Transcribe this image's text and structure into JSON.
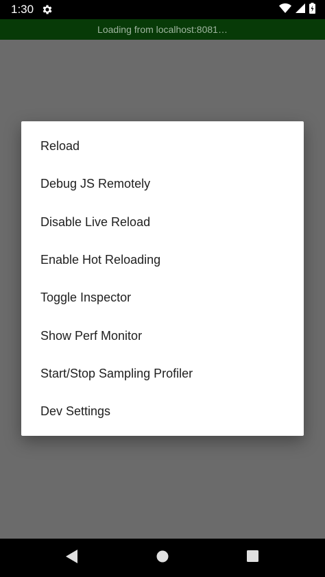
{
  "status_bar": {
    "time": "1:30"
  },
  "banner": {
    "text": "Loading from localhost:8081…"
  },
  "dev_menu": {
    "items": [
      {
        "label": "Reload"
      },
      {
        "label": "Debug JS Remotely"
      },
      {
        "label": "Disable Live Reload"
      },
      {
        "label": "Enable Hot Reloading"
      },
      {
        "label": "Toggle Inspector"
      },
      {
        "label": "Show Perf Monitor"
      },
      {
        "label": "Start/Stop Sampling Profiler"
      },
      {
        "label": "Dev Settings"
      }
    ]
  },
  "icons": {
    "status_left": "gear-icon",
    "status_right": [
      "wifi-icon",
      "signal-icon",
      "battery-icon"
    ],
    "nav": [
      "back-icon",
      "home-icon",
      "recents-icon"
    ]
  },
  "colors": {
    "banner_bg": "#073a07",
    "banner_text": "#9fb59f",
    "scrim": "#6b6b6b",
    "dialog_bg": "#ffffff"
  }
}
